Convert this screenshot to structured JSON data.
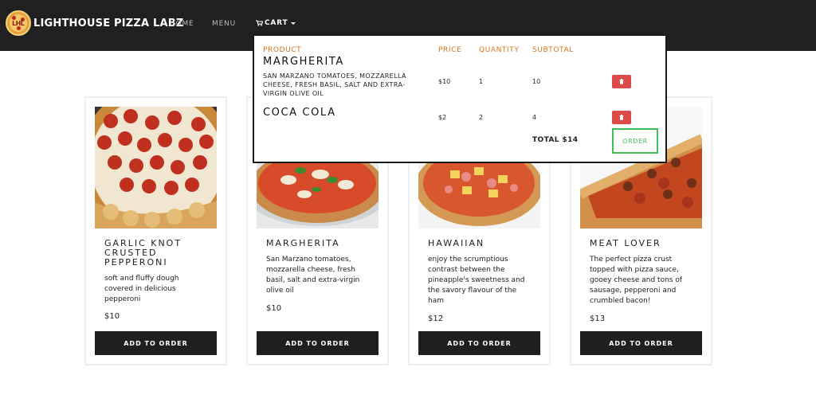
{
  "nav": {
    "brand": "LIGHTHOUSE PIZZA LABZ",
    "logo_text": "LHL",
    "home": "HOME",
    "menu": "MENU",
    "cart": "CART"
  },
  "cart": {
    "headers": {
      "product": "PRODUCT",
      "price": "PRICE",
      "quantity": "QUANTITY",
      "subtotal": "SUBTOTAL"
    },
    "items": [
      {
        "name": "MARGHERITA",
        "description": "San Marzano tomatoes, mozzarella cheese, fresh basil, salt and extra-virgin olive oil",
        "price": "$10",
        "quantity": "1",
        "subtotal": "10"
      },
      {
        "name": "COCA COLA",
        "description": "",
        "price": "$2",
        "quantity": "2",
        "subtotal": "4"
      }
    ],
    "total": "TOTAL $14",
    "order_label": "ORDER"
  },
  "products": [
    {
      "title": "GARLIC KNOT CRUSTED PEPPERONI",
      "description": "soft and fluffy dough covered in delicious pepperoni",
      "price": "$10",
      "button": "ADD TO ORDER"
    },
    {
      "title": "MARGHERITA",
      "description": "San Marzano tomatoes, mozzarella cheese, fresh basil, salt and extra-virgin olive oil",
      "price": "$10",
      "button": "ADD TO ORDER"
    },
    {
      "title": "HAWAIIAN",
      "description": "enjoy the scrumptious contrast between the pineapple's sweetness and the savory flavour of the ham",
      "price": "$12",
      "button": "ADD TO ORDER"
    },
    {
      "title": "MEAT LOVER",
      "description": "The perfect pizza crust topped with pizza sauce, gooey cheese and tons of sausage, pepperoni and crumbled bacon!",
      "price": "$13",
      "button": "ADD TO ORDER"
    }
  ],
  "colors": {
    "navbar": "#202020",
    "accent_orange": "#d4731c",
    "delete_red": "#dc4a4a",
    "order_green": "#3fbf5a",
    "button_dark": "#1f1f1f"
  },
  "icons": {
    "cart": "cart-icon",
    "delete": "trash-icon"
  }
}
